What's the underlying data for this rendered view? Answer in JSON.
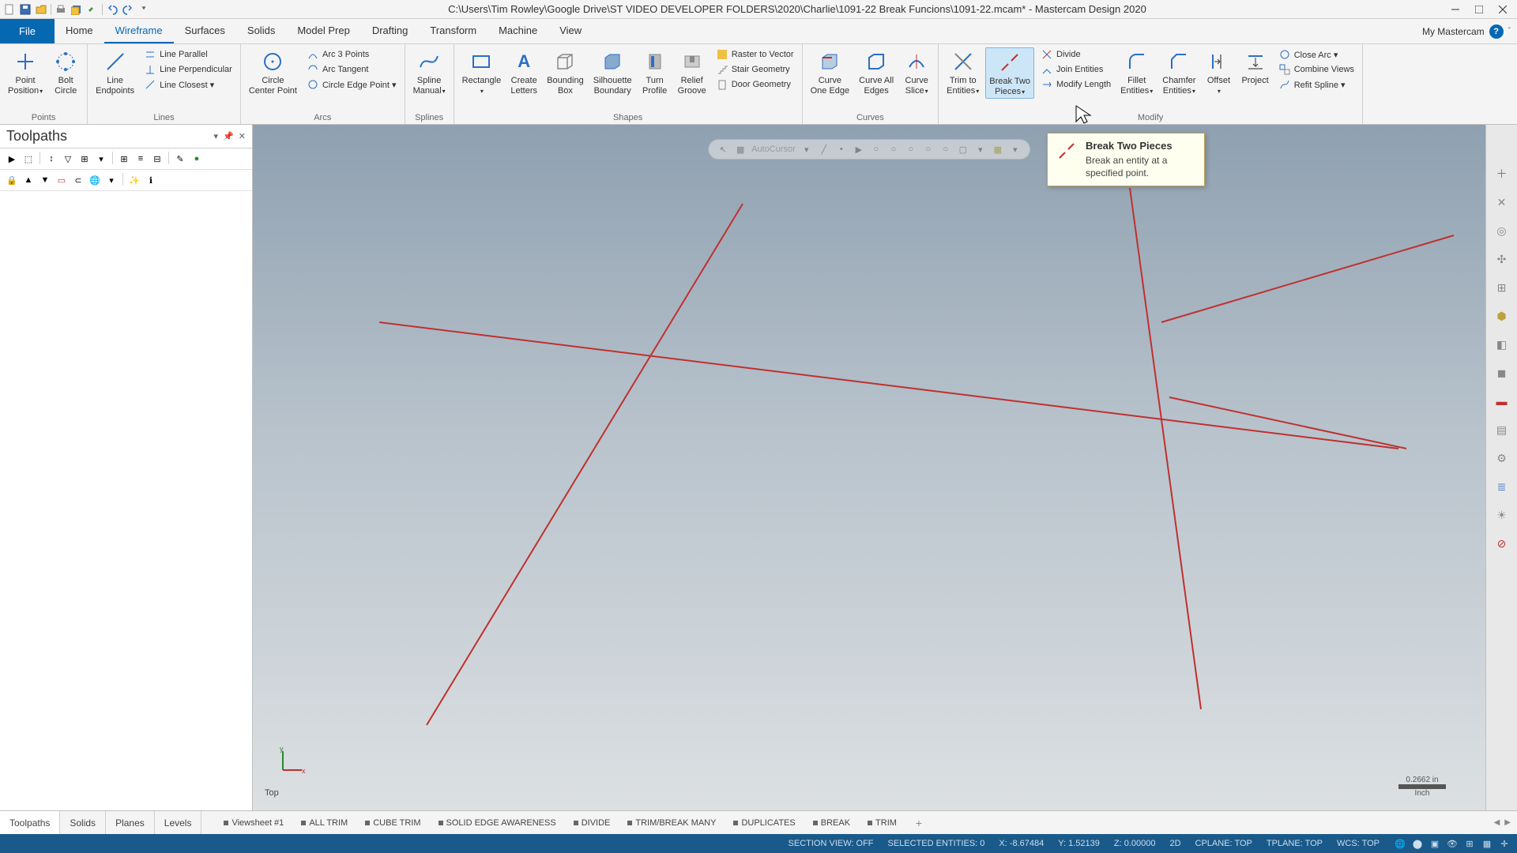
{
  "titlebar": {
    "path": "C:\\Users\\Tim Rowley\\Google Drive\\ST VIDEO DEVELOPER FOLDERS\\2020\\Charlie\\1091-22 Break Funcions\\1091-22.mcam* - Mastercam Design 2020"
  },
  "tabs": {
    "file": "File",
    "items": [
      "Home",
      "Wireframe",
      "Surfaces",
      "Solids",
      "Model Prep",
      "Drafting",
      "Transform",
      "Machine",
      "View"
    ],
    "active": 1,
    "right": "My Mastercam"
  },
  "ribbon": {
    "groups": [
      {
        "label": "Points",
        "large": [
          {
            "label": "Point\nPosition",
            "dd": true
          },
          {
            "label": "Bolt\nCircle"
          }
        ]
      },
      {
        "label": "Lines",
        "large": [
          {
            "label": "Line\nEndpoints"
          }
        ],
        "small_cols": [
          [
            "Line Parallel",
            "Line Perpendicular",
            "Line Closest ▾"
          ]
        ]
      },
      {
        "label": "Arcs",
        "large": [
          {
            "label": "Circle\nCenter Point"
          }
        ],
        "small_cols": [
          [
            "Arc 3 Points",
            "Arc Tangent",
            "Circle Edge Point ▾"
          ]
        ]
      },
      {
        "label": "Splines",
        "large": [
          {
            "label": "Spline\nManual",
            "dd": true
          }
        ]
      },
      {
        "label": "Shapes",
        "large": [
          {
            "label": "Rectangle",
            "dd": true
          },
          {
            "label": "Create\nLetters"
          },
          {
            "label": "Bounding\nBox"
          },
          {
            "label": "Silhouette\nBoundary"
          },
          {
            "label": "Turn\nProfile"
          },
          {
            "label": "Relief\nGroove"
          }
        ],
        "small_cols": [
          [
            "Raster to Vector",
            "Stair Geometry",
            "Door Geometry"
          ]
        ]
      },
      {
        "label": "Curves",
        "large": [
          {
            "label": "Curve\nOne Edge"
          },
          {
            "label": "Curve All\nEdges"
          },
          {
            "label": "Curve\nSlice",
            "dd": true
          }
        ]
      },
      {
        "label": "Modify",
        "large": [
          {
            "label": "Trim to\nEntities",
            "dd": true
          },
          {
            "label": "Break Two\nPieces",
            "dd": true,
            "active": true
          },
          {
            "label": "Fillet\nEntities",
            "dd": true
          },
          {
            "label": "Chamfer\nEntities",
            "dd": true
          },
          {
            "label": "Offset",
            "dd": true
          },
          {
            "label": "Project"
          }
        ],
        "small_cols_left": [
          [
            "Divide",
            "Join Entities",
            "Modify Length"
          ]
        ],
        "small_cols_right": [
          [
            "Close Arc ▾",
            "Combine Views",
            "Refit Spline ▾"
          ]
        ]
      }
    ]
  },
  "panel": {
    "title": "Toolpaths"
  },
  "floatbar": {
    "text": "AutoCursor"
  },
  "tooltip": {
    "title": "Break Two Pieces",
    "desc": "Break an entity at a specified point."
  },
  "viewport": {
    "label": "Top",
    "scale_value": "0.2662 in",
    "scale_unit": "Inch"
  },
  "doctabs": {
    "left": [
      "Toolpaths",
      "Solids",
      "Planes",
      "Levels"
    ],
    "views": [
      "Viewsheet #1",
      "ALL TRIM",
      "CUBE TRIM",
      "SOLID EDGE AWARENESS",
      "DIVIDE",
      "TRIM/BREAK MANY",
      "DUPLICATES",
      "BREAK",
      "TRIM"
    ]
  },
  "status": {
    "section": "SECTION VIEW: OFF",
    "selected": "SELECTED ENTITIES: 0",
    "x": "X: -8.67484",
    "y": "Y: 1.52139",
    "z": "Z: 0.00000",
    "mode": "2D",
    "cplane": "CPLANE: TOP",
    "tplane": "TPLANE: TOP",
    "wcs": "WCS: TOP"
  }
}
